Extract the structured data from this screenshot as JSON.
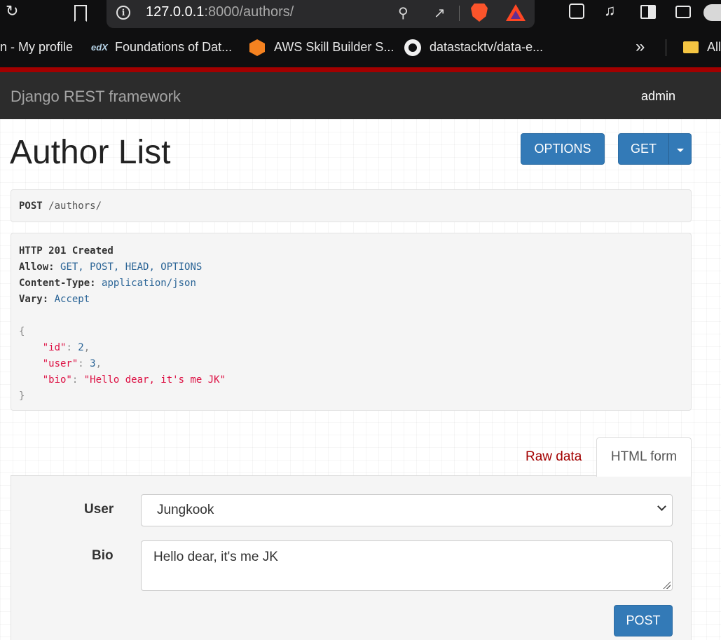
{
  "browser": {
    "url_host": "127.0.0.1",
    "url_rest": ":8000/authors/",
    "bookmarks": [
      {
        "label": "n - My profile"
      },
      {
        "label": "Foundations of Dat...",
        "icon_text": "edX"
      },
      {
        "label": "AWS Skill Builder S..."
      },
      {
        "label": "datastacktv/data-e..."
      },
      {
        "label": "All"
      }
    ],
    "overflow": "»"
  },
  "navbar": {
    "brand": "Django REST framework",
    "user": "admin",
    "accent_color": "#a30000"
  },
  "page": {
    "title": "Author List",
    "options_label": "OPTIONS",
    "get_label": "GET",
    "button_color": "#337ab7"
  },
  "request": {
    "method": "POST",
    "path": "/authors/"
  },
  "response": {
    "status": "HTTP 201 Created",
    "headers": [
      {
        "name": "Allow:",
        "value": "GET, POST, HEAD, OPTIONS"
      },
      {
        "name": "Content-Type:",
        "value": "application/json"
      },
      {
        "name": "Vary:",
        "value": "Accept"
      }
    ],
    "body": {
      "open": "{",
      "close": "}",
      "fields": [
        {
          "key": "\"id\"",
          "value": "2",
          "type": "num"
        },
        {
          "key": "\"user\"",
          "value": "3",
          "type": "num"
        },
        {
          "key": "\"bio\"",
          "value": "\"Hello dear, it's me JK\"",
          "type": "str"
        }
      ]
    }
  },
  "tabs": {
    "raw": "Raw data",
    "html": "HTML form"
  },
  "form": {
    "user_label": "User",
    "user_value": "Jungkook",
    "bio_label": "Bio",
    "bio_value": "Hello dear, it's me JK",
    "submit_label": "POST"
  }
}
